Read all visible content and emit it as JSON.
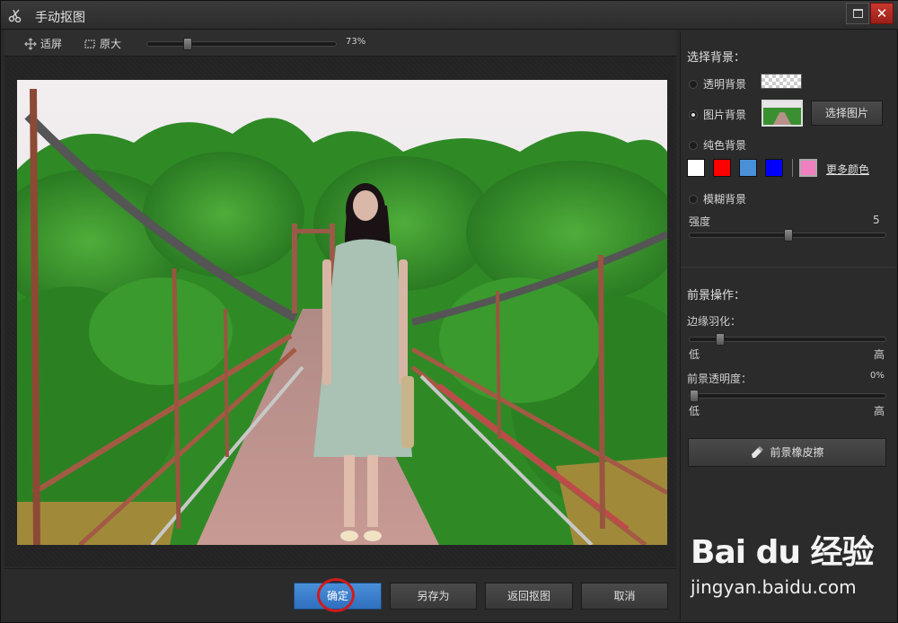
{
  "window": {
    "title": "手动抠图"
  },
  "toolbar": {
    "fit_label": "适屏",
    "original_label": "原大",
    "zoom_value": "73%",
    "zoom_fraction": 0.2
  },
  "panel": {
    "bg_title": "选择背景：",
    "transparent_label": "透明背景",
    "image_label": "图片背景",
    "choose_image_label": "选择图片",
    "solid_label": "纯色背景",
    "colors": [
      "#ffffff",
      "#ff0000",
      "#4a90d9",
      "#0000ff",
      "#f080c0"
    ],
    "more_colors_label": "更多颜色",
    "blur_label": "模糊背景",
    "strength_label": "强度",
    "strength_value": "5",
    "strength_fraction": 0.5,
    "fg_title": "前景操作：",
    "feather_label": "边缘羽化：",
    "feather_fraction": 0.14,
    "low_label": "低",
    "high_label": "高",
    "opacity_label": "前景透明度：",
    "opacity_value": "0%",
    "opacity_fraction": 0.0,
    "eraser_label": "前景橡皮擦",
    "selected_background": "image"
  },
  "bottom": {
    "confirm_label": "确定",
    "save_as_label": "另存为",
    "back_label": "返回抠图",
    "cancel_label": "取消"
  },
  "watermark": {
    "logo_text": "Bai du 经验",
    "url": "jingyan.baidu.com"
  },
  "icons": {
    "app": "scissors-icon",
    "maximize": "maximize-icon",
    "close": "close-icon",
    "fit": "fit-screen-icon",
    "original": "original-size-icon",
    "eraser": "eraser-icon"
  }
}
